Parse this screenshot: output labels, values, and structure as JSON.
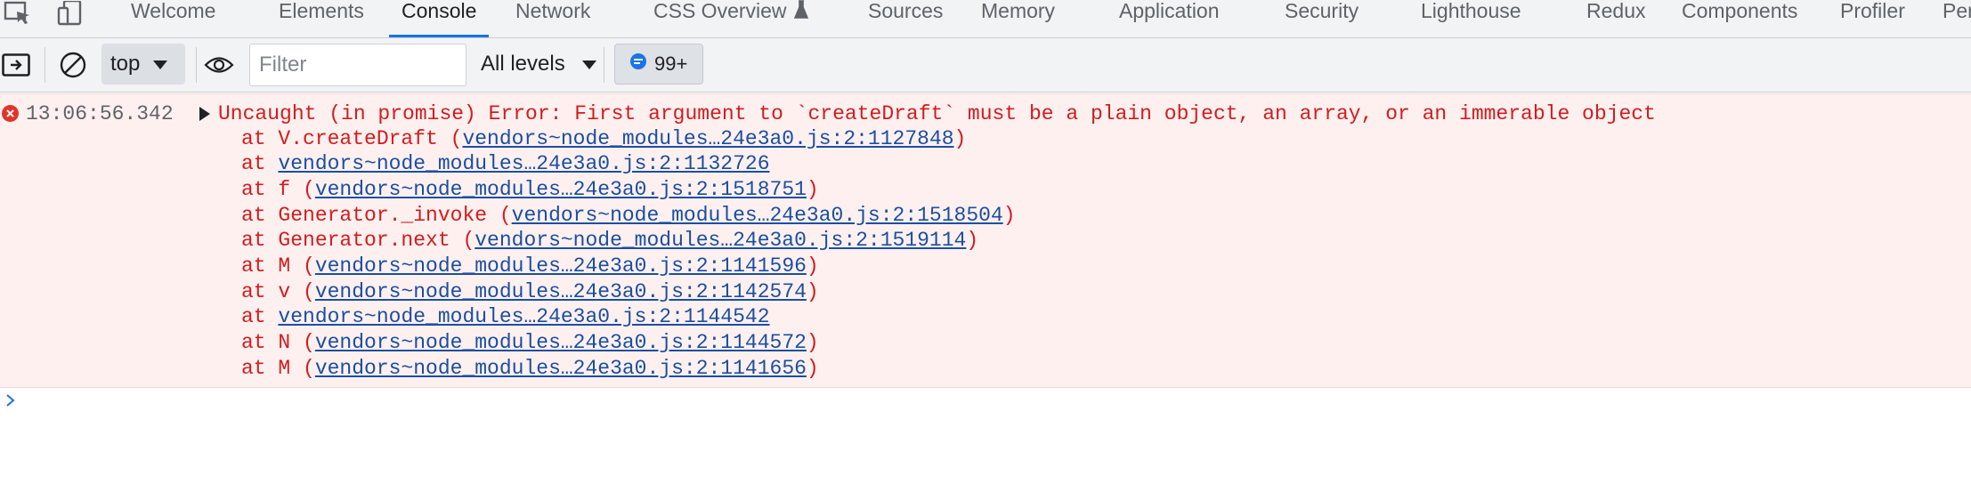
{
  "tabs": [
    {
      "label": "Welcome",
      "active": false
    },
    {
      "label": "Elements",
      "active": false
    },
    {
      "label": "Console",
      "active": true
    },
    {
      "label": "Network",
      "active": false
    },
    {
      "label": "CSS Overview",
      "active": false,
      "icon": "flask-icon"
    },
    {
      "label": "Sources",
      "active": false
    },
    {
      "label": "Memory",
      "active": false
    },
    {
      "label": "Application",
      "active": false
    },
    {
      "label": "Security",
      "active": false
    },
    {
      "label": "Lighthouse",
      "active": false
    },
    {
      "label": "Redux",
      "active": false
    },
    {
      "label": "Components",
      "active": false
    },
    {
      "label": "Profiler",
      "active": false
    },
    {
      "label": "Per",
      "active": false
    }
  ],
  "toolbar": {
    "context": "top",
    "filter_placeholder": "Filter",
    "filter_value": "",
    "levels": "All levels",
    "issues_count": "99+"
  },
  "error": {
    "timestamp": "13:06:56.342",
    "message": "Uncaught (in promise) Error: First argument to `createDraft` must be a plain object, an array, or an immerable object",
    "stack": [
      {
        "prefix": "at V.createDraft (",
        "link": "vendors~node_modules…24e3a0.js:2:1127848",
        "suffix": ")"
      },
      {
        "prefix": "at ",
        "link": "vendors~node_modules…24e3a0.js:2:1132726",
        "suffix": ""
      },
      {
        "prefix": "at f (",
        "link": "vendors~node_modules…24e3a0.js:2:1518751",
        "suffix": ")"
      },
      {
        "prefix": "at Generator._invoke (",
        "link": "vendors~node_modules…24e3a0.js:2:1518504",
        "suffix": ")"
      },
      {
        "prefix": "at Generator.next (",
        "link": "vendors~node_modules…24e3a0.js:2:1519114",
        "suffix": ")"
      },
      {
        "prefix": "at M (",
        "link": "vendors~node_modules…24e3a0.js:2:1141596",
        "suffix": ")"
      },
      {
        "prefix": "at v (",
        "link": "vendors~node_modules…24e3a0.js:2:1142574",
        "suffix": ")"
      },
      {
        "prefix": "at ",
        "link": "vendors~node_modules…24e3a0.js:2:1144542",
        "suffix": ""
      },
      {
        "prefix": "at N (",
        "link": "vendors~node_modules…24e3a0.js:2:1144572",
        "suffix": ")"
      },
      {
        "prefix": "at M (",
        "link": "vendors~node_modules…24e3a0.js:2:1141656",
        "suffix": ")"
      }
    ]
  },
  "colors": {
    "error_text": "#d21c1c",
    "link": "#1a4fa0",
    "error_bg": "#fff0f0",
    "accent": "#1a73e8"
  }
}
